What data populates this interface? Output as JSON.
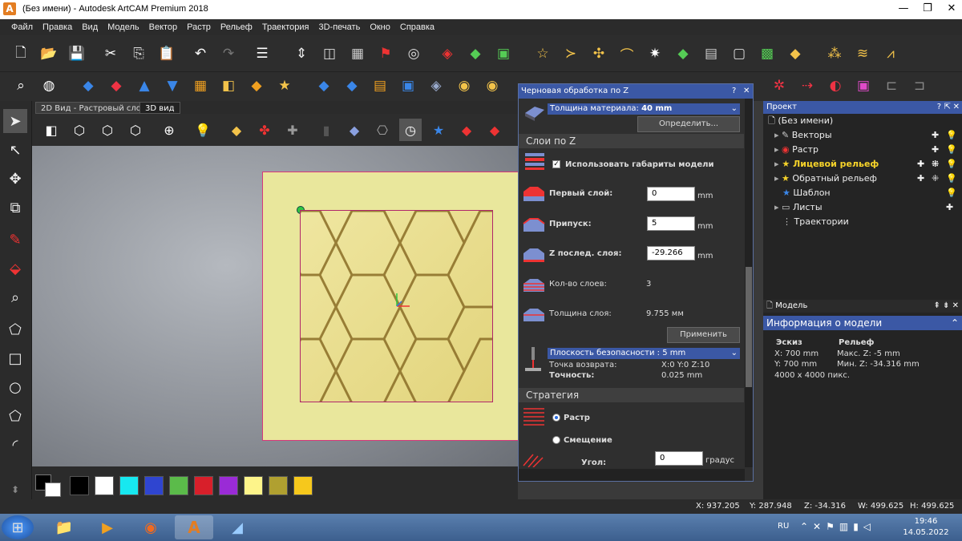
{
  "window": {
    "title": "(Без имени) - Autodesk ArtCAM Premium 2018",
    "logo": "A"
  },
  "menu": [
    "Файл",
    "Правка",
    "Вид",
    "Модель",
    "Вектор",
    "Растр",
    "Рельеф",
    "Траектория",
    "3D-печать",
    "Окно",
    "Справка"
  ],
  "view_tabs": [
    "2D Вид - Растровый слой",
    "3D вид"
  ],
  "dialog": {
    "title": "Черновая обработка по Z",
    "material_label": "Толщина материала:",
    "material_value": "40 mm",
    "define_button": "Определить...",
    "section_layers": "Слои по Z",
    "use_model_dims": "Использовать габариты модели",
    "first_layer_label": "Первый слой:",
    "first_layer_value": "0",
    "allowance_label": "Припуск:",
    "allowance_value": "5",
    "last_z_label": "Z послед. слоя:",
    "last_z_value": "-29.266",
    "unit_mm": "mm",
    "layers_count_label": "Кол-во слоев:",
    "layers_count_value": "3",
    "layer_thickness_label": "Толщина слоя:",
    "layer_thickness_value": "9.755 мм",
    "apply_button": "Применить",
    "safe_plane": "Плоскость безопасности : 5 mm",
    "return_point_label": "Точка возврата:",
    "return_point_value": "X:0 Y:0 Z:10",
    "accuracy_label": "Точность:",
    "accuracy_value": "0.025 mm",
    "section_strategy": "Стратегия",
    "strategy_raster": "Растр",
    "strategy_offset": "Смещение",
    "angle_label": "Угол:",
    "angle_value": "0",
    "angle_unit": "градус"
  },
  "project": {
    "header": "Проект",
    "root": "(Без имени)",
    "items": [
      "Векторы",
      "Растр",
      "Лицевой рельеф",
      "Обратный рельеф",
      "Шаблон",
      "Листы",
      "Траектории"
    ]
  },
  "model_panel": {
    "header": "Модель",
    "info_header": "Информация о модели",
    "sketch_title": "Эскиз",
    "relief_title": "Рельеф",
    "x": "X: 700 mm",
    "y": "Y: 700 mm",
    "pixels": "4000 x 4000 пикс.",
    "max_z": "Макс. Z: -5 mm",
    "min_z": "Мин. Z: -34.316 mm"
  },
  "status": {
    "x": "X: 937.205",
    "y": "Y: 287.948",
    "z": "Z: -34.316",
    "w": "W: 499.625",
    "h": "H: 499.625"
  },
  "taskbar": {
    "lang": "RU",
    "time": "19:46",
    "date": "14.05.2022"
  },
  "palette": [
    "#000000",
    "#ffffff",
    "#17e8f0",
    "#2f45d0",
    "#5bbb4a",
    "#d81f2a",
    "#9a2bd6",
    "#fdf48a",
    "#b0a030",
    "#f6c81c"
  ]
}
